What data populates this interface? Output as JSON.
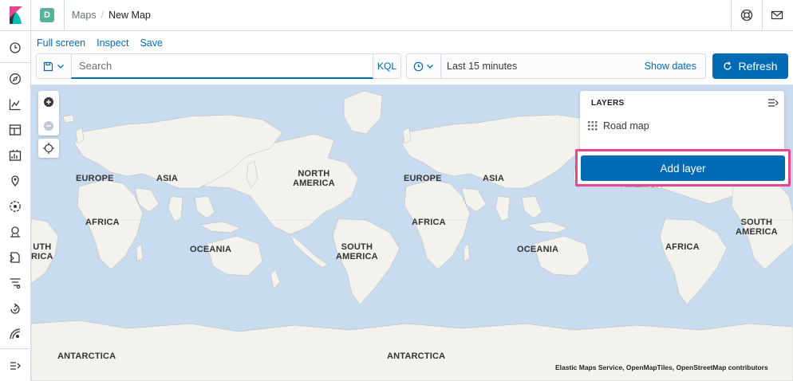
{
  "header": {
    "space_initial": "D",
    "breadcrumbs": [
      "Maps",
      "New Map"
    ]
  },
  "menu": {
    "full_screen": "Full screen",
    "inspect": "Inspect",
    "save": "Save"
  },
  "query": {
    "placeholder": "Search",
    "language": "KQL"
  },
  "time": {
    "range": "Last 15 minutes",
    "show_dates": "Show dates"
  },
  "refresh_label": "Refresh",
  "layers": {
    "title": "LAYERS",
    "items": [
      {
        "name": "Road map",
        "icon": "grid-icon"
      }
    ],
    "add_layer": "Add layer"
  },
  "map_labels": [
    {
      "text": "EUROPE"
    },
    {
      "text": "ASIA"
    },
    {
      "text": "NORTH\nAMERICA"
    },
    {
      "text": "AFRICA"
    },
    {
      "text": "OCEANIA"
    },
    {
      "text": "SOUTH\nAMERICA"
    },
    {
      "text": "ANTARCTICA"
    },
    {
      "text": "EUROPE"
    },
    {
      "text": "ASIA"
    },
    {
      "text": "AFRICA"
    },
    {
      "text": "OCEANIA"
    },
    {
      "text": "SOUTH\nAMERICA"
    },
    {
      "text": "ANTARCTICA"
    },
    {
      "text": "AFRICA"
    },
    {
      "text": "SOUTH\nAMERICA"
    },
    {
      "text": "UTH\nRICA"
    },
    {
      "text": "AMERICA"
    }
  ],
  "attribution": "Elastic Maps Service, OpenMapTiles, OpenStreetMap contributors",
  "colors": {
    "accent": "#006bb4",
    "highlight": "#e8478b",
    "ocean": "#c9dcef",
    "land": "#f5f3ee",
    "space": "#54b399"
  }
}
